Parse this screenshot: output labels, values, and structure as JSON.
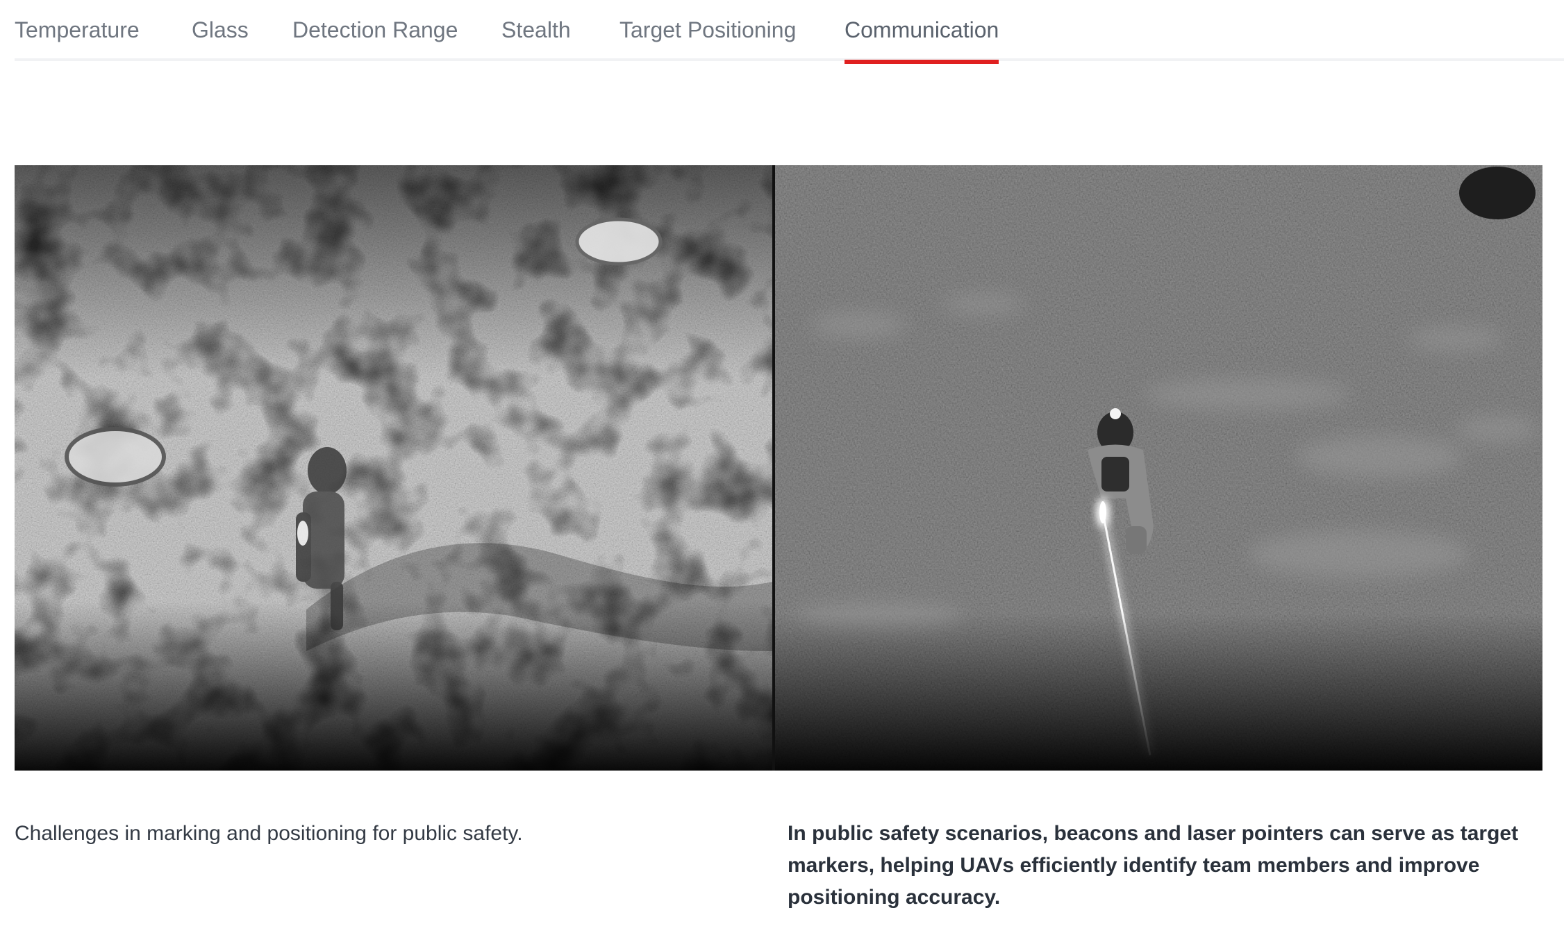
{
  "tabs": [
    {
      "label": "Temperature",
      "active": false
    },
    {
      "label": "Glass",
      "active": false
    },
    {
      "label": "Detection Range",
      "active": false
    },
    {
      "label": "Stealth",
      "active": false
    },
    {
      "label": "Target Positioning",
      "active": false
    },
    {
      "label": "Communication",
      "active": true
    }
  ],
  "accent_color": "#e02020",
  "comparison": {
    "left_image": "thermal-image-without-marker",
    "right_image": "thermal-image-with-laser-marker"
  },
  "captions": {
    "left": "Challenges in marking and positioning for public safety.",
    "right": "In public safety scenarios, beacons and laser pointers can serve as target markers, helping UAVs efficiently identify team members and improve positioning accuracy."
  }
}
